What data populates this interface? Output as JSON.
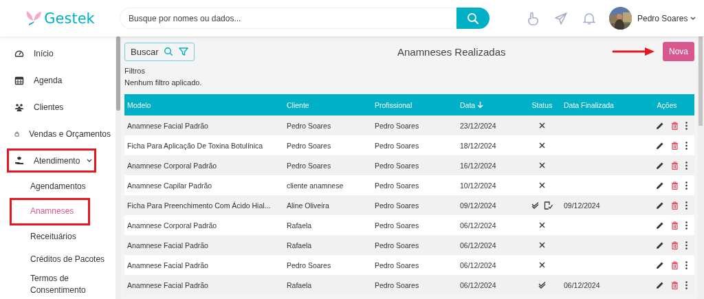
{
  "logo": {
    "text": "Gestek"
  },
  "search": {
    "placeholder": "Busque por nomes ou dados..."
  },
  "user": {
    "name": "Pedro Soares"
  },
  "sidebar": {
    "items": [
      {
        "label": "Início",
        "highlighted": false
      },
      {
        "label": "Agenda",
        "highlighted": false
      },
      {
        "label": "Clientes",
        "highlighted": false
      },
      {
        "label": "Vendas e Orçamentos",
        "highlighted": false
      },
      {
        "label": "Atendimento",
        "highlighted": true,
        "expanded": true,
        "children": [
          {
            "label": "Agendamentos",
            "selected": false,
            "highlighted": false
          },
          {
            "label": "Anamneses",
            "selected": true,
            "highlighted": true
          },
          {
            "label": "Receituários",
            "selected": false,
            "highlighted": false
          },
          {
            "label": "Créditos de Pacotes",
            "selected": false,
            "highlighted": false
          },
          {
            "label": "Termos de Consentimento",
            "selected": false,
            "highlighted": false
          }
        ]
      }
    ]
  },
  "toolbar": {
    "search_button": "Buscar",
    "title": "Anamneses Realizadas",
    "new_button": {
      "label": "Nova",
      "pointed": true
    }
  },
  "filters": {
    "label": "Filtros",
    "value": "Nenhum filtro aplicado."
  },
  "table": {
    "columns": [
      "Modelo",
      "Cliente",
      "Profissional",
      "Data",
      "Status",
      "Data Finalizada",
      "Ações"
    ],
    "rows": [
      {
        "model": "Anamnese Facial Padrão",
        "client": "Pedro Soares",
        "professional": "Pedro Soares",
        "date": "23/12/2024",
        "completed": false,
        "signed": false
      },
      {
        "model": "Ficha Para Aplicação De Toxina Botulínica",
        "client": "Pedro Soares",
        "professional": "Pedro Soares",
        "date": "18/12/2024",
        "completed": false,
        "signed": false
      },
      {
        "model": "Anamnese Corporal Padrão",
        "client": "Pedro Soares",
        "professional": "Pedro Soares",
        "date": "16/12/2024",
        "completed": false,
        "signed": false
      },
      {
        "model": "Anamnese Capilar Padrão",
        "client": "cliente anamnese",
        "professional": "Pedro Soares",
        "date": "10/12/2024",
        "completed": false,
        "signed": false
      },
      {
        "model": "Ficha Para Preenchimento Com Ácido Hial...",
        "client": "Aline Oliveira",
        "professional": "Pedro Soares",
        "date": "09/12/2024",
        "completed": true,
        "signed": true,
        "finalized_date": "09/12/2024"
      },
      {
        "model": "Anamnese Corporal Padrão",
        "client": "Rafaela",
        "professional": "Pedro Soares",
        "date": "06/12/2024",
        "completed": false,
        "signed": false
      },
      {
        "model": "Anamnese Facial Padrão",
        "client": "Rafaela",
        "professional": "Pedro Soares",
        "date": "06/12/2024",
        "completed": false,
        "signed": false
      },
      {
        "model": "Anamnese Facial Padrão",
        "client": "Pedro Soares",
        "professional": "Pedro Soares",
        "date": "06/12/2024",
        "completed": false,
        "signed": false
      },
      {
        "model": "Anamnese Facial Padrão",
        "client": "Rafaela",
        "professional": "Pedro Soares",
        "date": "06/12/2024",
        "completed": true,
        "signed": false,
        "finalized_date": "06/12/2024"
      }
    ]
  }
}
